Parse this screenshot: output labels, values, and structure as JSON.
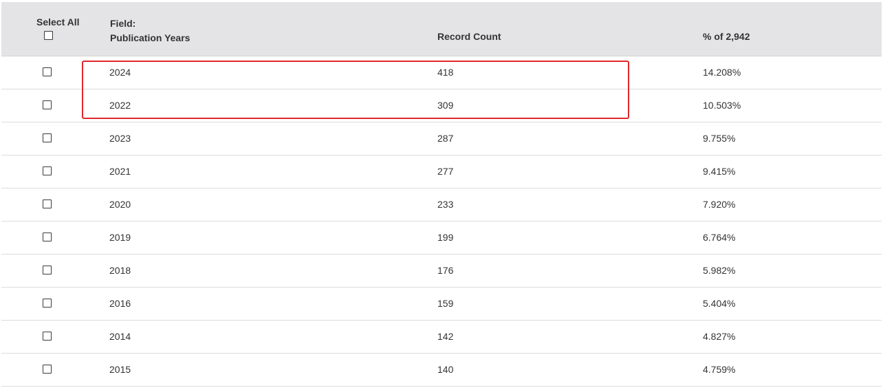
{
  "header": {
    "select_all": "Select All",
    "field_label": "Field:",
    "field_name": "Publication Years",
    "record_count": "Record Count",
    "percent": "% of 2,942"
  },
  "rows": [
    {
      "year": "2024",
      "count": "418",
      "pct": "14.208%"
    },
    {
      "year": "2022",
      "count": "309",
      "pct": "10.503%"
    },
    {
      "year": "2023",
      "count": "287",
      "pct": "9.755%"
    },
    {
      "year": "2021",
      "count": "277",
      "pct": "9.415%"
    },
    {
      "year": "2020",
      "count": "233",
      "pct": "7.920%"
    },
    {
      "year": "2019",
      "count": "199",
      "pct": "6.764%"
    },
    {
      "year": "2018",
      "count": "176",
      "pct": "5.982%"
    },
    {
      "year": "2016",
      "count": "159",
      "pct": "5.404%"
    },
    {
      "year": "2014",
      "count": "142",
      "pct": "4.827%"
    },
    {
      "year": "2015",
      "count": "140",
      "pct": "4.759%"
    }
  ],
  "colors": {
    "highlight": "#e0262a",
    "header_bg": "#e4e4e6"
  }
}
